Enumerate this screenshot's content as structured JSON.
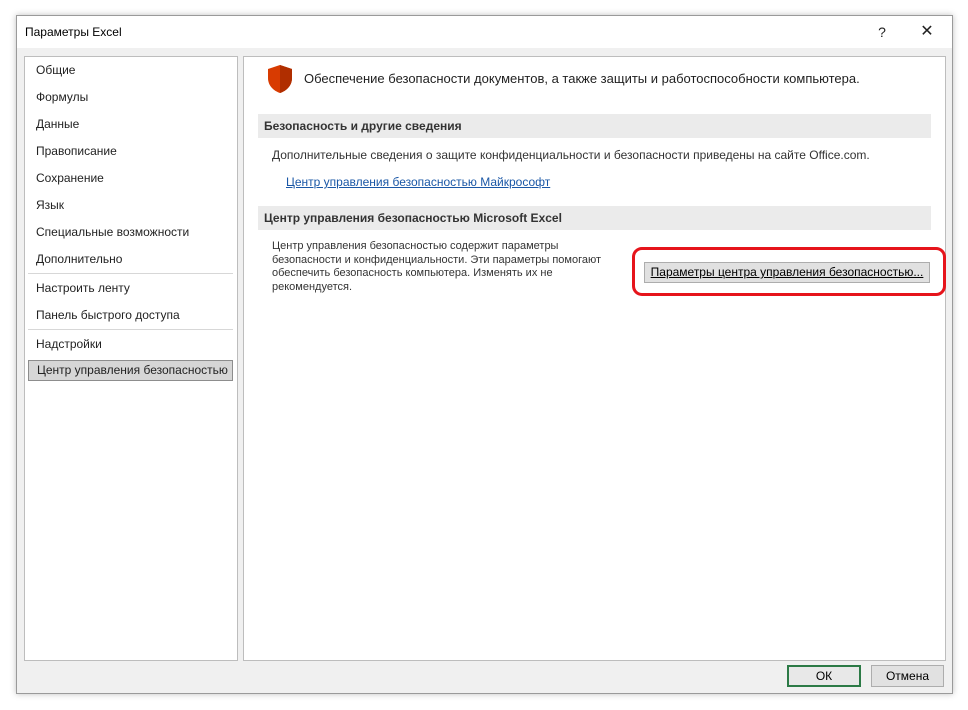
{
  "window": {
    "title": "Параметры Excel",
    "help_glyph": "?",
    "close_glyph": "✕"
  },
  "sidebar": {
    "items": [
      {
        "label": "Общие"
      },
      {
        "label": "Формулы"
      },
      {
        "label": "Данные"
      },
      {
        "label": "Правописание"
      },
      {
        "label": "Сохранение"
      },
      {
        "label": "Язык"
      },
      {
        "label": "Специальные возможности"
      },
      {
        "label": "Дополнительно"
      },
      {
        "label": "Настроить ленту"
      },
      {
        "label": "Панель быстрого доступа"
      },
      {
        "label": "Надстройки"
      },
      {
        "label": "Центр управления безопасностью"
      }
    ],
    "selected": "Центр управления безопасностью"
  },
  "content": {
    "header_icon": "shield-icon",
    "header_text": "Обеспечение безопасности документов, а также защиты и работоспособности компьютера.",
    "security_section": {
      "title": "Безопасность и другие сведения",
      "text": "Дополнительные сведения о защите конфиденциальности и безопасности приведены на сайте Office.com.",
      "link": "Центр управления безопасностью Майкрософт"
    },
    "trust_center_section": {
      "title": "Центр управления безопасностью Microsoft Excel",
      "description": "Центр управления безопасностью содержит параметры безопасности и конфиденциальности. Эти параметры помогают обеспечить безопасность компьютера. Изменять их не рекомендуется.",
      "button_label": "Параметры центра управления безопасностью..."
    }
  },
  "footer": {
    "ok_label": "ОК",
    "cancel_label": "Отмена"
  },
  "colors": {
    "highlight": "#e6141b",
    "shield": "#d83b01",
    "link": "#1a57a6",
    "ok_border": "#2c7a46"
  }
}
